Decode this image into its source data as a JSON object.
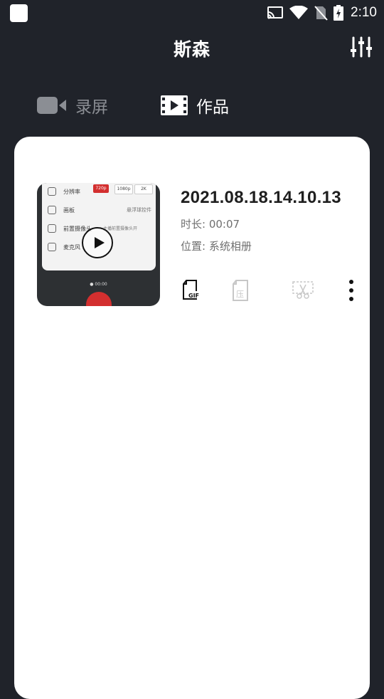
{
  "status_bar": {
    "time": "2:10",
    "icons": [
      "cast-icon",
      "wifi-icon",
      "no-sim-icon",
      "battery-charging-icon"
    ]
  },
  "app_bar": {
    "title": "斯森",
    "settings_icon": "tune-icon"
  },
  "tabs": [
    {
      "label": "录屏",
      "icon": "video-camera-icon",
      "active": false
    },
    {
      "label": "作品",
      "icon": "film-icon",
      "active": true
    }
  ],
  "video": {
    "name": "2021.08.18.14.10.13",
    "duration": "时长: 00:07",
    "location": "位置: 系统相册",
    "thumbnail": {
      "rows": [
        "分辨率",
        "画板",
        "前置摄像头",
        "麦克风"
      ],
      "pills": [
        "720p",
        "1080p",
        "2K"
      ],
      "side_text_1": "悬浮球控件",
      "side_text_2": "主播前置摄像头开",
      "rec_time": "● 00:00"
    },
    "actions": [
      {
        "name": "gif-icon",
        "label": "GIF"
      },
      {
        "name": "compress-icon",
        "label": "压"
      },
      {
        "name": "cut-icon"
      },
      {
        "name": "more-icon"
      }
    ]
  },
  "colors": {
    "background": "#20232a",
    "card": "#ffffff",
    "tab_inactive": "#8b8e94",
    "record_red": "#d32f2f"
  }
}
